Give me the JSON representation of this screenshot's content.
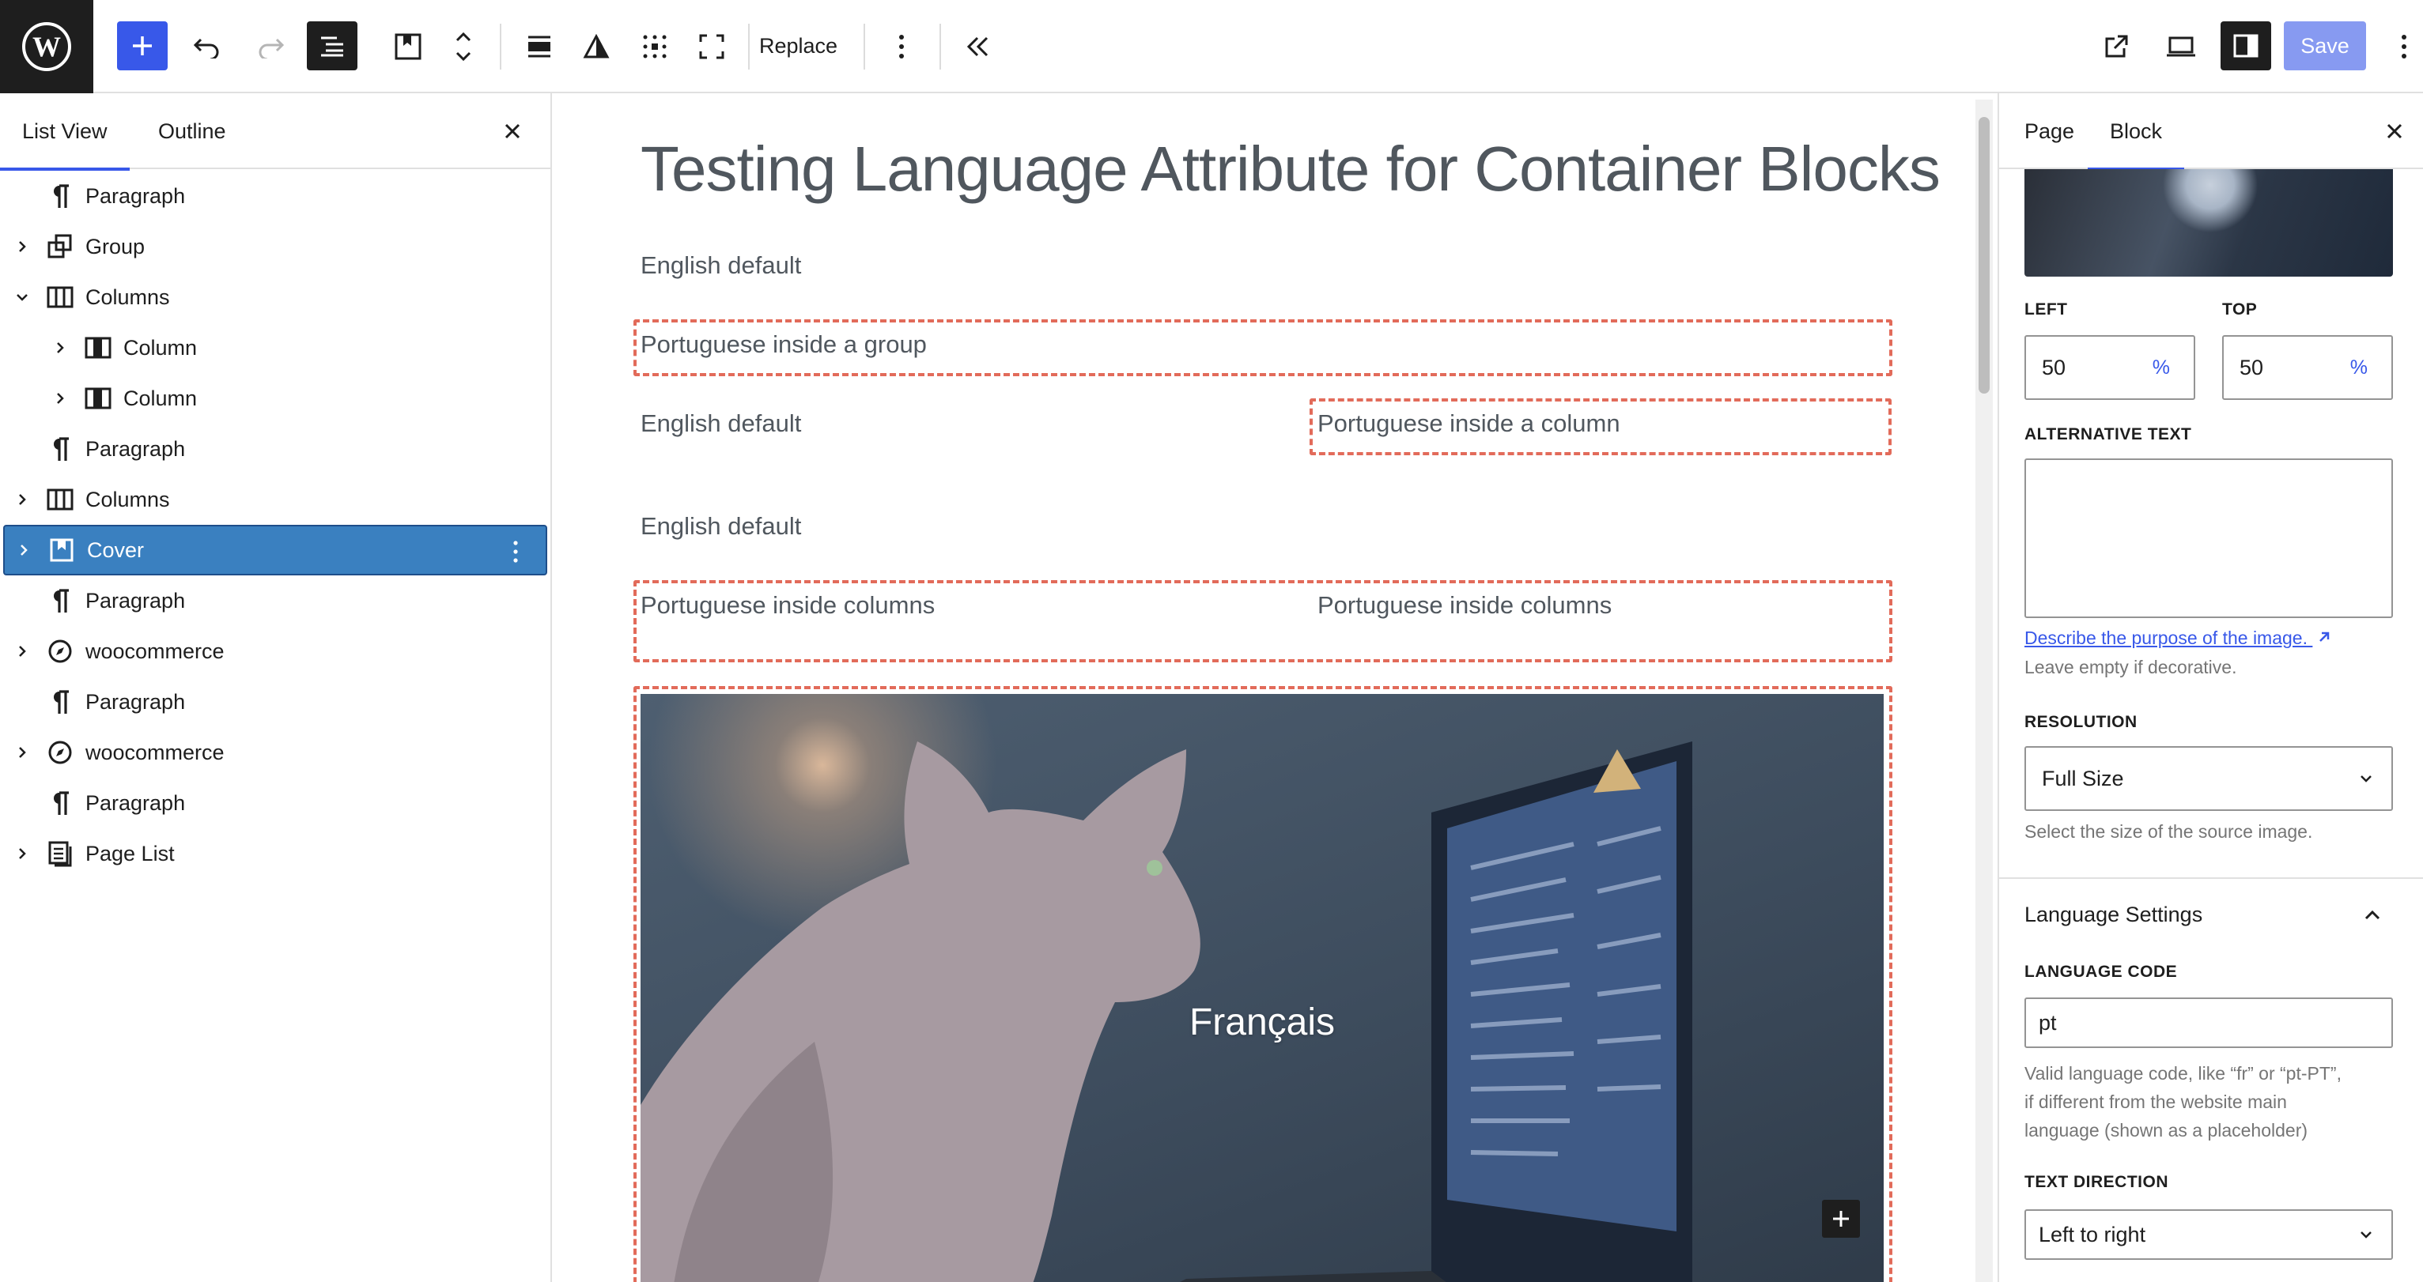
{
  "toolbar": {
    "replace_label": "Replace",
    "save_label": "Save"
  },
  "list_panel": {
    "tabs": [
      {
        "label": "List View",
        "active": true
      },
      {
        "label": "Outline",
        "active": false
      }
    ],
    "items": [
      {
        "label": "Paragraph",
        "icon": "paragraph-icon",
        "expandable": false,
        "expanded": false,
        "level": 0,
        "selected": false
      },
      {
        "label": "Group",
        "icon": "group-icon",
        "expandable": true,
        "expanded": false,
        "level": 0,
        "selected": false
      },
      {
        "label": "Columns",
        "icon": "columns-icon",
        "expandable": true,
        "expanded": true,
        "level": 0,
        "selected": false
      },
      {
        "label": "Column",
        "icon": "column-icon",
        "expandable": true,
        "expanded": false,
        "level": 1,
        "selected": false
      },
      {
        "label": "Column",
        "icon": "column-icon",
        "expandable": true,
        "expanded": false,
        "level": 1,
        "selected": false
      },
      {
        "label": "Paragraph",
        "icon": "paragraph-icon",
        "expandable": false,
        "expanded": false,
        "level": 0,
        "selected": false
      },
      {
        "label": "Columns",
        "icon": "columns-icon",
        "expandable": true,
        "expanded": false,
        "level": 0,
        "selected": false
      },
      {
        "label": "Cover",
        "icon": "cover-icon",
        "expandable": true,
        "expanded": false,
        "level": 0,
        "selected": true
      },
      {
        "label": "Paragraph",
        "icon": "paragraph-icon",
        "expandable": false,
        "expanded": false,
        "level": 0,
        "selected": false
      },
      {
        "label": "woocommerce",
        "icon": "compass-icon",
        "expandable": true,
        "expanded": false,
        "level": 0,
        "selected": false
      },
      {
        "label": "Paragraph",
        "icon": "paragraph-icon",
        "expandable": false,
        "expanded": false,
        "level": 0,
        "selected": false
      },
      {
        "label": "woocommerce",
        "icon": "compass-icon",
        "expandable": true,
        "expanded": false,
        "level": 0,
        "selected": false
      },
      {
        "label": "Paragraph",
        "icon": "paragraph-icon",
        "expandable": false,
        "expanded": false,
        "level": 0,
        "selected": false
      },
      {
        "label": "Page List",
        "icon": "page-list-icon",
        "expandable": true,
        "expanded": false,
        "level": 0,
        "selected": false
      }
    ]
  },
  "canvas": {
    "title": "Testing Language Attribute for Container Blocks",
    "p1": "English default",
    "group_text": "Portuguese inside a group",
    "col_left": "English default",
    "col_right": "Portuguese inside a column",
    "p2": "English default",
    "cols_left": "Portuguese inside columns",
    "cols_right": "Portuguese inside columns",
    "cover_text": "Français"
  },
  "sidebar": {
    "tabs": [
      {
        "label": "Page",
        "active": false
      },
      {
        "label": "Block",
        "active": true
      }
    ],
    "left_label": "LEFT",
    "left_value": "50",
    "top_label": "TOP",
    "top_value": "50",
    "unit": "%",
    "alt_label": "ALTERNATIVE TEXT",
    "alt_value": "",
    "alt_link": "Describe the purpose of the image.",
    "alt_help": "Leave empty if decorative.",
    "resolution_label": "RESOLUTION",
    "resolution_value": "Full Size",
    "resolution_help": "Select the size of the source image.",
    "lang_panel_title": "Language Settings",
    "lang_code_label": "LANGUAGE CODE",
    "lang_code_value": "pt",
    "lang_help_1": "Valid language code, like “fr” or “pt-PT”,",
    "lang_help_2": "if different from the website main",
    "lang_help_3": "language (shown as a placeholder)",
    "text_dir_label": "TEXT DIRECTION",
    "text_dir_value": "Left to right"
  },
  "colors": {
    "accent": "#3858e9",
    "selected_row": "#3a80c0",
    "dashed_outline": "#e26b5a"
  }
}
